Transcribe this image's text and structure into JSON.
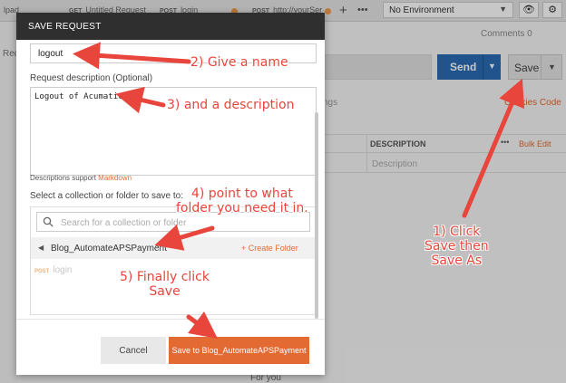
{
  "background": {
    "left_text": "lpad",
    "tabs": [
      {
        "method": "GET",
        "label": "Untitled Request"
      },
      {
        "method": "POST",
        "label": "login"
      },
      {
        "method": "POST",
        "label": "http://yourSer"
      }
    ],
    "more": "•••",
    "environment": "No Environment",
    "comments": "Comments",
    "comments_count": "0",
    "send_label": "Send",
    "save_label": "Save",
    "cookies_code": "Cookies  Code",
    "partial_tab_text": "ngs",
    "left_partial": "Req",
    "description_header": "DESCRIPTION",
    "bulk_edit": "Bulk Edit",
    "description_placeholder": "Description",
    "for_you": "For you"
  },
  "modal": {
    "title": "SAVE REQUEST",
    "name_value": "logout",
    "description_label": "Request description (Optional)",
    "description_value": "Logout of Acumatica",
    "markdown_note": "Descriptions support ",
    "markdown_link": "Markdown",
    "select_label": "Select a collection or folder to save to:",
    "search_placeholder": "Search for a collection or folder",
    "folder_name": "Blog_AutomateAPSPayment",
    "create_folder": "+ Create Folder",
    "request_method": "POST",
    "request_name": "login",
    "cancel_label": "Cancel",
    "save_to_label": "Save to Blog_AutomateAPSPayment"
  },
  "annotations": {
    "step1": "1) Click\nSave then\nSave As",
    "step2": "2) Give a name",
    "step3": "3) and a description",
    "step4": "4) point to what\nfolder you need it in.",
    "step5": "5) Finally click\nSave"
  },
  "colors": {
    "accent_orange": "#e36a33",
    "send_blue": "#2b6cb5",
    "annotation_red": "#e8453c",
    "header_dark": "#2f2f2f"
  }
}
